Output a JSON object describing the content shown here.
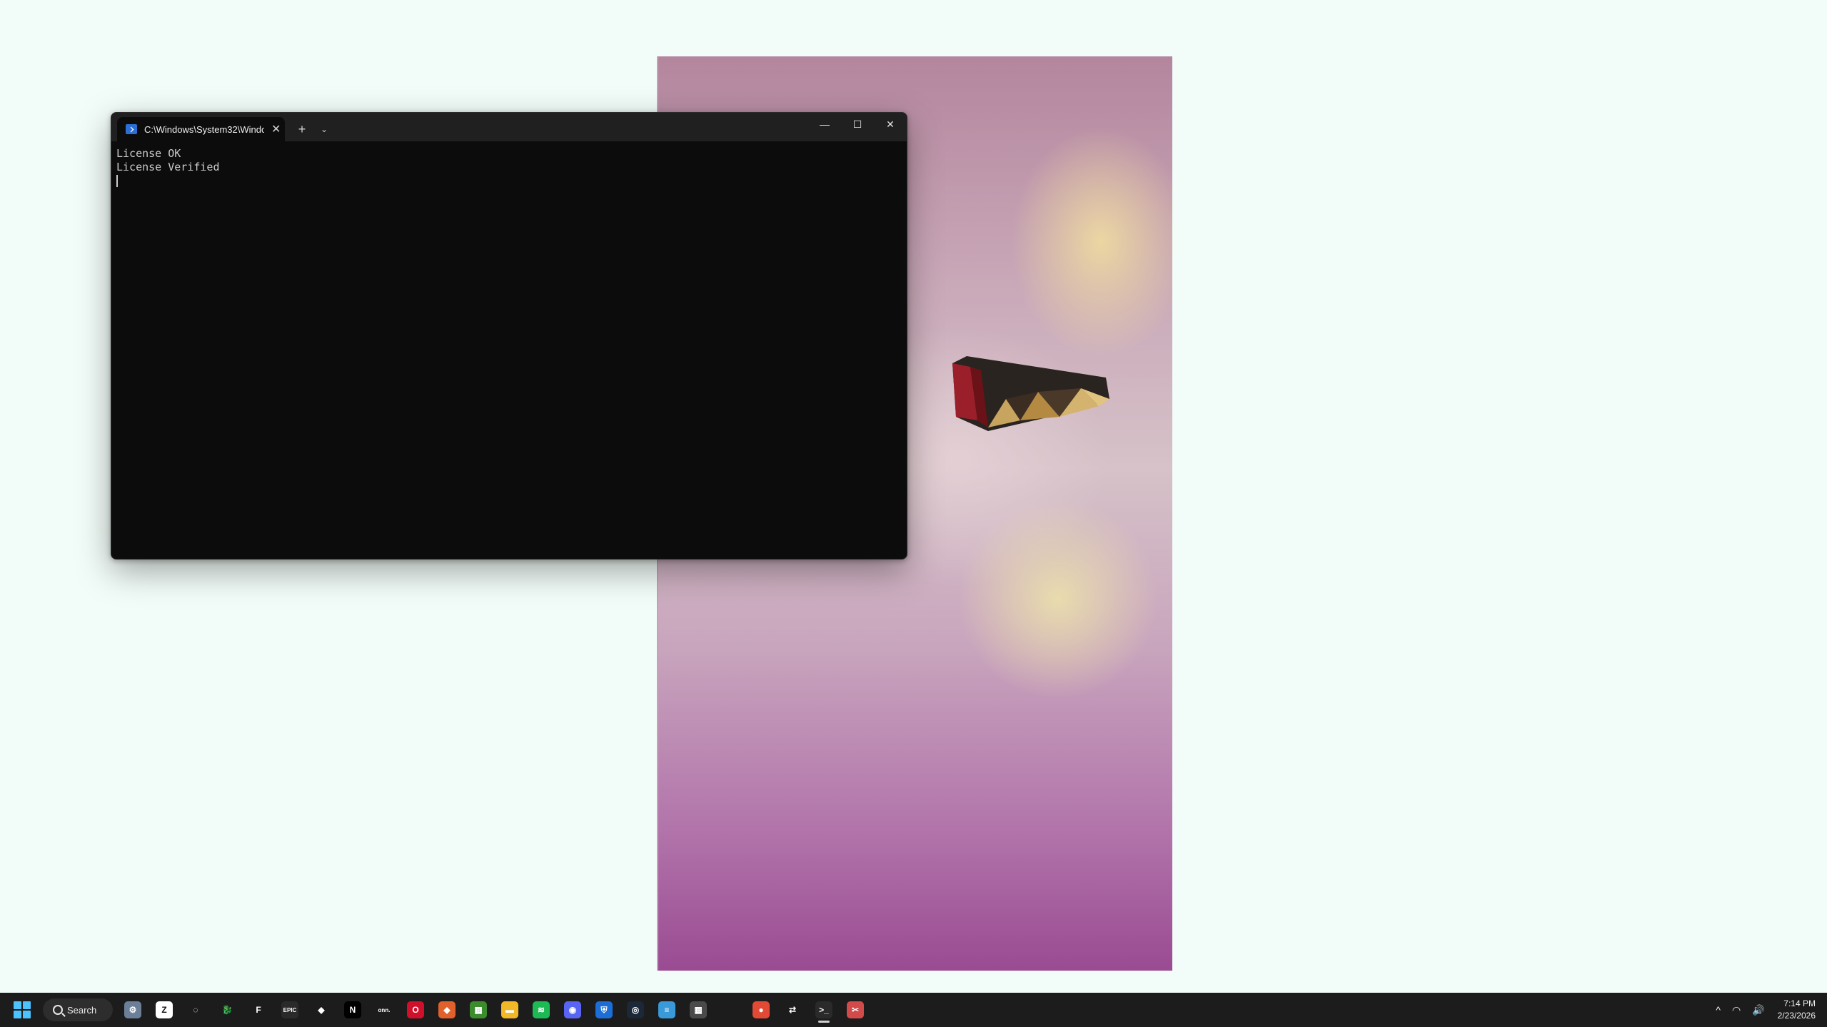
{
  "terminal": {
    "tab_title": "C:\\Windows\\System32\\Windo",
    "tab_close": "✕",
    "new_tab": "+",
    "dropdown": "⌄",
    "minimize": "—",
    "maximize": "☐",
    "close": "✕",
    "lines": [
      "License OK",
      "License Verified"
    ]
  },
  "taskbar": {
    "search_label": "Search",
    "apps": [
      {
        "name": "settings-icon",
        "glyph": "⚙",
        "color": "#6b7f99"
      },
      {
        "name": "notion-like-icon",
        "glyph": "Z",
        "color": "#ffffff",
        "fg": "#111111"
      },
      {
        "name": "ring-icon",
        "glyph": "◌",
        "color": "#1c1c1c"
      },
      {
        "name": "dragon-icon",
        "glyph": "🐉",
        "color": "#1c1c1c"
      },
      {
        "name": "fortnite-icon",
        "glyph": "F",
        "color": "#1c1c1c"
      },
      {
        "name": "epic-games-icon",
        "glyph": "EPIC",
        "color": "#2a2a2a"
      },
      {
        "name": "mask-icon",
        "glyph": "◆",
        "color": "#1c1c1c"
      },
      {
        "name": "nvidia-icon",
        "glyph": "N",
        "color": "#000000"
      },
      {
        "name": "onn-icon",
        "glyph": "onn.",
        "color": "#1c1c1c"
      },
      {
        "name": "opera-icon",
        "glyph": "O",
        "color": "#d0102a"
      },
      {
        "name": "brave-icon",
        "glyph": "◆",
        "color": "#e0612b"
      },
      {
        "name": "minecraft-icon",
        "glyph": "▦",
        "color": "#3c8c2e"
      },
      {
        "name": "file-explorer-icon",
        "glyph": "▬",
        "color": "#f2b827"
      },
      {
        "name": "spotify-icon",
        "glyph": "≋",
        "color": "#1db954"
      },
      {
        "name": "discord-icon",
        "glyph": "◉",
        "color": "#5865f2"
      },
      {
        "name": "defender-icon",
        "glyph": "⛨",
        "color": "#1c6ed6"
      },
      {
        "name": "steam-icon",
        "glyph": "◎",
        "color": "#1b2838"
      },
      {
        "name": "notepad-icon",
        "glyph": "≡",
        "color": "#3a9ad9"
      },
      {
        "name": "calculator-icon",
        "glyph": "▦",
        "color": "#4a4a4a"
      },
      {
        "name": "blank-app-icon",
        "glyph": "",
        "color": "#1c1c1c"
      },
      {
        "name": "chrome-icon",
        "glyph": "●",
        "color": "#e24a36"
      },
      {
        "name": "arrows-icon",
        "glyph": "⇄",
        "color": "#1c1c1c"
      },
      {
        "name": "terminal-icon",
        "glyph": ">_",
        "color": "#2a2a2a",
        "active": true
      },
      {
        "name": "snipping-tool-icon",
        "glyph": "✂",
        "color": "#d24a4a"
      }
    ],
    "tray": {
      "chevron": "^",
      "wifi": "◠",
      "volume": "🔊"
    },
    "time": "7:14 PM",
    "date": "2/23/2026"
  }
}
